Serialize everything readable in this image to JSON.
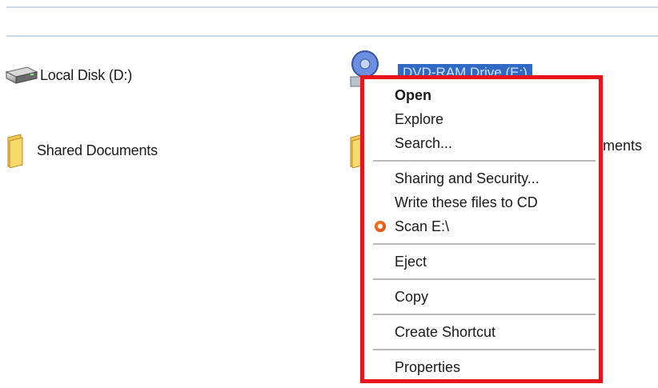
{
  "explorer": {
    "drives": [
      {
        "label": "Local Disk (D:)",
        "icon": "hard-disk-icon"
      },
      {
        "label": "Shared Documents",
        "icon": "folder-icon"
      }
    ],
    "selected_item_label": "DVD-RAM Drive (E:)",
    "partial_label": "ments"
  },
  "context_menu": {
    "items": [
      {
        "label": "Open",
        "bold": true
      },
      {
        "label": "Explore"
      },
      {
        "label": "Search..."
      },
      {
        "label": "Sharing and Security..."
      },
      {
        "label": "Write these files to CD"
      },
      {
        "label": "Scan E:\\",
        "icon": "scan-icon"
      },
      {
        "label": "Eject"
      },
      {
        "label": "Copy"
      },
      {
        "label": "Create Shortcut"
      },
      {
        "label": "Properties"
      }
    ],
    "highlight_color": "#e8141b"
  }
}
